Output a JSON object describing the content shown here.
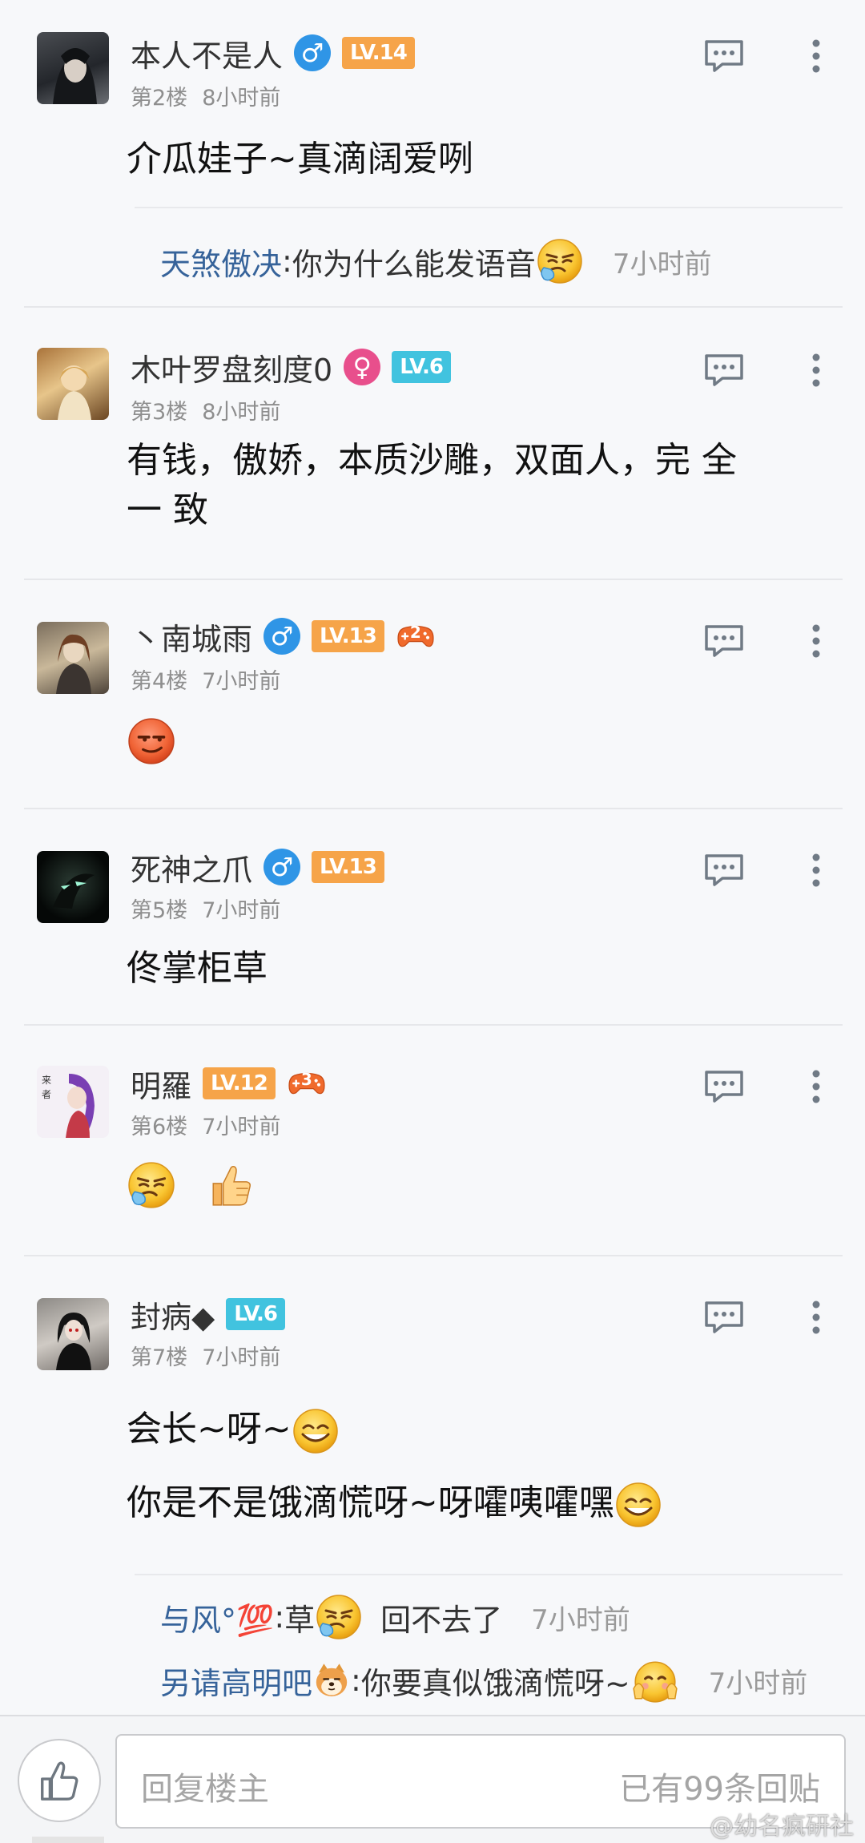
{
  "posts": [
    {
      "username": "本人不是人",
      "gender": "♂",
      "level": "LV.14",
      "floor": "第2楼",
      "time": "8小时前",
      "content": "介瓜娃子~真滴阔爱咧",
      "sub_replies": [
        {
          "author": "天煞傲决",
          "sep": ":",
          "text": "你为什么能发语音",
          "emoji": "sneeze-emoji",
          "time": "7小时前"
        }
      ]
    },
    {
      "username": "木叶罗盘刻度0",
      "gender": "♀",
      "level": "LV.6",
      "floor": "第3楼",
      "time": "8小时前",
      "content_line1": "有钱，傲娇，本质沙雕，双面人，完 全",
      "content_line2": "一 致"
    },
    {
      "username": "丶南城雨",
      "gender": "♂",
      "level": "LV.13",
      "badge": "2",
      "floor": "第4楼",
      "time": "7小时前",
      "emojis": [
        "smug-emoji"
      ]
    },
    {
      "username": "死神之爪",
      "gender": "♂",
      "level": "LV.13",
      "floor": "第5楼",
      "time": "7小时前",
      "content": "佟掌柜草"
    },
    {
      "username": "明羅",
      "level": "LV.12",
      "badge": "3",
      "floor": "第6楼",
      "time": "7小时前",
      "emojis": [
        "sneeze-emoji",
        "thumbs-up-emoji"
      ]
    },
    {
      "username": "封病◆",
      "level": "LV.6",
      "floor": "第7楼",
      "time": "7小时前",
      "content_line1": "会长~呀~",
      "content_line2": "你是不是饿滴慌呀~呀嚯咦嚯嘿",
      "sub_replies": [
        {
          "author": "与风°💯",
          "sep": ":",
          "text": "草",
          "text2": "回不去了",
          "time": "7小时前"
        },
        {
          "author": "另请高明吧",
          "sep": ":",
          "text": "你要真似饿滴慌呀~",
          "time": "7小时前"
        }
      ]
    }
  ],
  "bottom_bar": {
    "reply_placeholder": "回复楼主",
    "reply_count": "已有99条回贴",
    "watermark": "@幼名疯研社"
  },
  "colors": {
    "male": "#2f95e6",
    "female": "#e84f8c",
    "level_orange": "#f6a449",
    "level_cyan": "#41c3df",
    "sub_author": "#36639a"
  }
}
